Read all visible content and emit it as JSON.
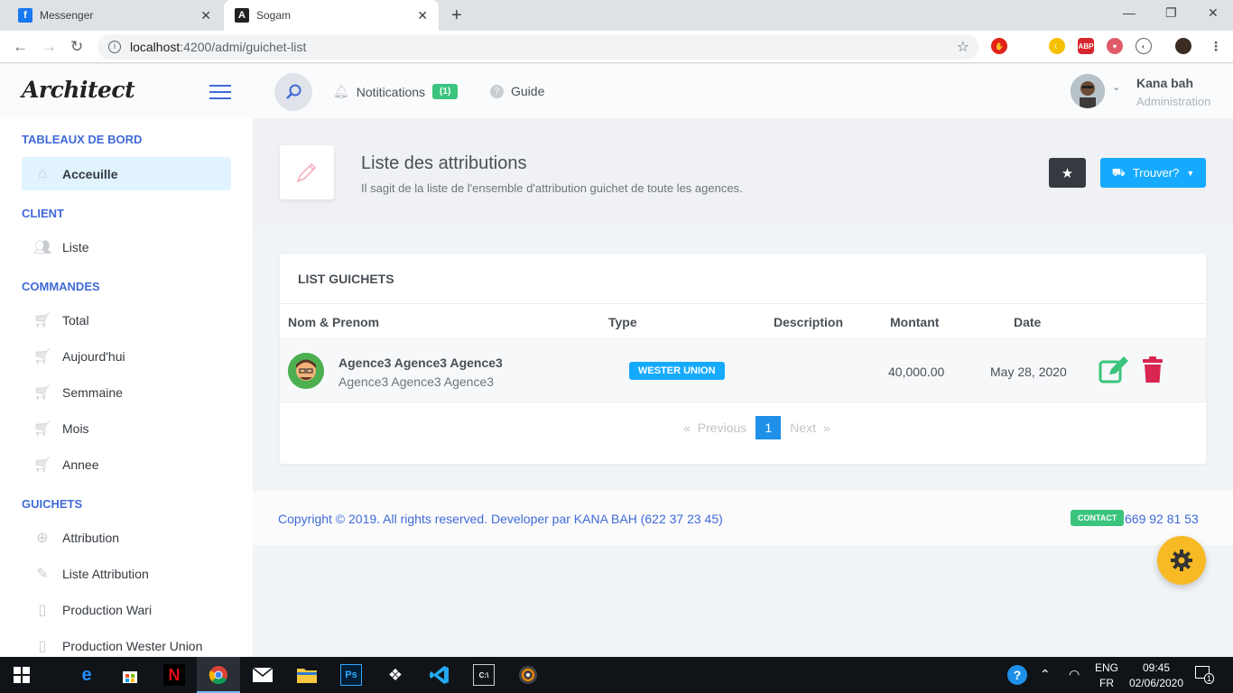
{
  "browser": {
    "tabs": [
      {
        "title": "Messenger",
        "icon": "facebook-icon"
      },
      {
        "title": "Sogam",
        "icon": "angular-icon"
      }
    ],
    "url_host": "localhost",
    "url_rest": ":4200/admi/guichet-list"
  },
  "header": {
    "logo": "Architect",
    "notifications_label": "Notitications",
    "notifications_count": "(1)",
    "guide_label": "Guide",
    "user_name": "Kana bah",
    "user_role": "Administration"
  },
  "sidebar": {
    "sections": [
      {
        "title": "TABLEAUX DE BORD",
        "items": [
          {
            "label": "Acceuille",
            "icon": "home-icon",
            "active": true
          }
        ]
      },
      {
        "title": "CLIENT",
        "items": [
          {
            "label": "Liste",
            "icon": "users-icon"
          }
        ]
      },
      {
        "title": "COMMANDES",
        "items": [
          {
            "label": "Total",
            "icon": "cart-icon"
          },
          {
            "label": "Aujourd'hui",
            "icon": "cart-icon"
          },
          {
            "label": "Semmaine",
            "icon": "cart-icon"
          },
          {
            "label": "Mois",
            "icon": "cart-icon"
          },
          {
            "label": "Annee",
            "icon": "cart-icon"
          }
        ]
      },
      {
        "title": "GUICHETS",
        "items": [
          {
            "label": "Attribution",
            "icon": "plus-circle-icon"
          },
          {
            "label": "Liste Attribution",
            "icon": "pen-icon"
          },
          {
            "label": "Production Wari",
            "icon": "bottle-icon"
          },
          {
            "label": "Production Wester Union",
            "icon": "bottle-icon"
          }
        ]
      }
    ]
  },
  "page": {
    "title": "Liste des attributions",
    "subtitle": "Il sagit de la liste de l'ensemble d'attribution guichet de toute les agences.",
    "find_button": "Trouver?"
  },
  "card": {
    "title": "LIST GUICHETS",
    "columns": [
      "Nom & Prenom",
      "Type",
      "Description",
      "Montant",
      "Date"
    ],
    "rows": [
      {
        "name": "Agence3 Agence3 Agence3",
        "sub": "Agence3 Agence3 Agence3",
        "type": "WESTER UNION",
        "description": "",
        "amount": "40,000.00",
        "date": "May 28, 2020"
      }
    ],
    "pagination": {
      "prev": "Previous",
      "page": "1",
      "next": "Next",
      "prev_arrow": "«",
      "next_arrow": "»"
    }
  },
  "footer": {
    "copyright": "Copyright © 2019. All rights reserved. Developer par KANA BAH (622 37 23 45)",
    "contact_label": "CONTACT",
    "phone": "669 92 81 53"
  },
  "taskbar": {
    "lang1": "ENG",
    "lang2": "FR",
    "time": "09:45",
    "date": "02/06/2020",
    "notif_count": "1"
  },
  "colors": {
    "primary": "#3f6ad8",
    "info": "#16aaff",
    "success": "#3ac47d",
    "danger": "#d92550",
    "warning": "#f7b924"
  }
}
